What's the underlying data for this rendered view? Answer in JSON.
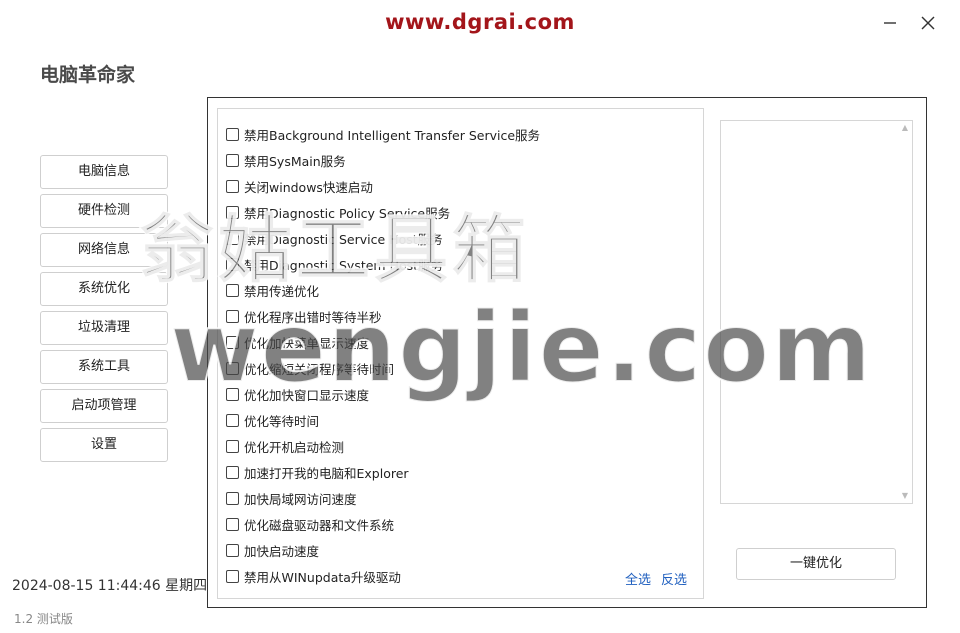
{
  "watermark_top": "www.dgrai.com",
  "app_title": "电脑革命家",
  "nav": [
    {
      "label": "电脑信息"
    },
    {
      "label": "硬件检测"
    },
    {
      "label": "网络信息"
    },
    {
      "label": "系统优化"
    },
    {
      "label": "垃圾清理"
    },
    {
      "label": "系统工具"
    },
    {
      "label": "启动项管理"
    },
    {
      "label": "设置"
    }
  ],
  "datetime": "2024-08-15 11:44:46  星期四",
  "version": "1.2  测试版",
  "options": [
    {
      "label": "禁用Background Intelligent Transfer Service服务",
      "checked": false
    },
    {
      "label": "禁用SysMain服务",
      "checked": false
    },
    {
      "label": "关闭windows快速启动",
      "checked": false
    },
    {
      "label": "禁用Diagnostic Policy Service服务",
      "checked": false
    },
    {
      "label": "禁用Diagnostic Service Host服务",
      "checked": false
    },
    {
      "label": "禁用Diagnostic System Host服务",
      "checked": false
    },
    {
      "label": "禁用传递优化",
      "checked": false
    },
    {
      "label": "优化程序出错时等待半秒",
      "checked": false
    },
    {
      "label": "优化加快菜单显示速度",
      "checked": false
    },
    {
      "label": "优化缩短关闭程序等待时间",
      "checked": false
    },
    {
      "label": "优化加快窗口显示速度",
      "checked": false
    },
    {
      "label": "优化等待时间",
      "checked": false
    },
    {
      "label": "优化开机启动检测",
      "checked": false
    },
    {
      "label": "加速打开我的电脑和Explorer",
      "checked": false
    },
    {
      "label": "加快局域网访问速度",
      "checked": false
    },
    {
      "label": "优化磁盘驱动器和文件系统",
      "checked": false
    },
    {
      "label": "加快启动速度",
      "checked": false
    },
    {
      "label": "禁用从WINupdata升级驱动",
      "checked": false
    }
  ],
  "select_all": "全选",
  "select_invert": "反选",
  "optimize_button": "一键优化",
  "overlay_watermark_cn": "翁姑工具箱",
  "overlay_watermark_en": "wengjie.com",
  "colors": {
    "watermark_top": "#a3151a",
    "link": "#1f5fbf"
  }
}
